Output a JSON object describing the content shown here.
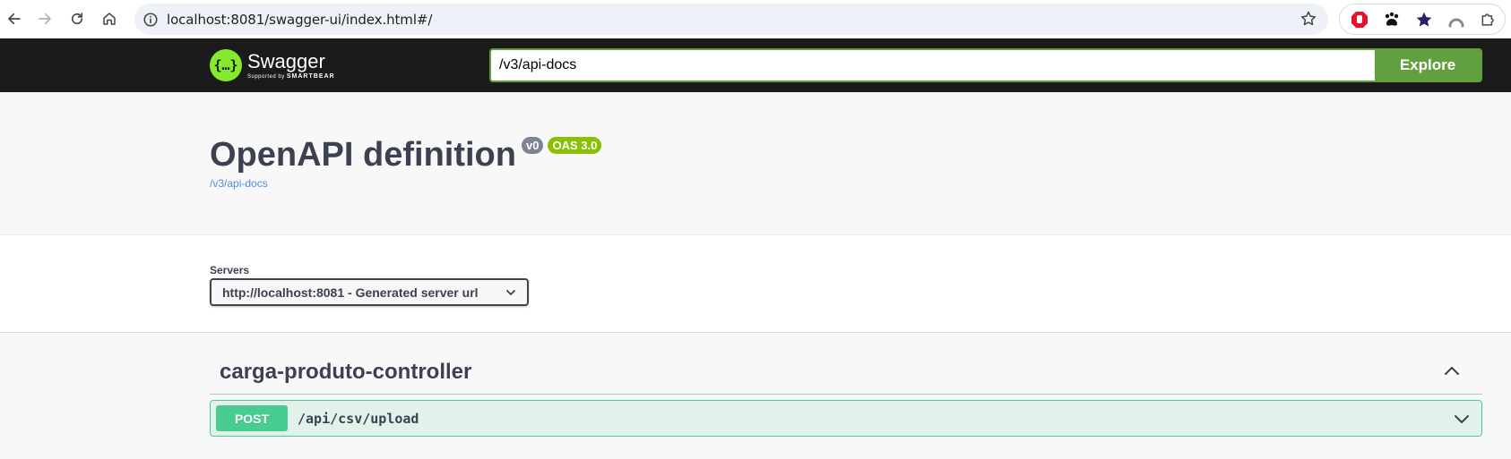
{
  "browser": {
    "url": "localhost:8081/swagger-ui/index.html#/",
    "icons": [
      "back-arrow-icon",
      "forward-arrow-icon",
      "reload-icon",
      "home-icon",
      "site-info-icon",
      "bookmark-star-icon"
    ],
    "extensions": [
      "adblock-icon",
      "paw-extension-icon",
      "star-extension-icon",
      "arc-extension-icon",
      "puzzle-extensions-icon"
    ]
  },
  "topbar": {
    "logo_title": "Swagger",
    "logo_sub_prefix": "Supported by",
    "logo_sub_brand": "SMARTBEAR",
    "explore_value": "/v3/api-docs",
    "explore_button": "Explore",
    "colors": {
      "background": "#1b1b1b",
      "accent": "#62a03f",
      "logo": "#85ea2d"
    }
  },
  "info": {
    "title": "OpenAPI definition",
    "version_badge": "v0",
    "oas_badge": "OAS 3.0",
    "spec_link": "/v3/api-docs"
  },
  "servers": {
    "label": "Servers",
    "selected": "http://localhost:8081 - Generated server url"
  },
  "operations": {
    "tag": "carga-produto-controller",
    "tag_expanded": true,
    "items": [
      {
        "method": "POST",
        "path": "/api/csv/upload",
        "color": "#49cc90",
        "expanded": false
      }
    ]
  }
}
